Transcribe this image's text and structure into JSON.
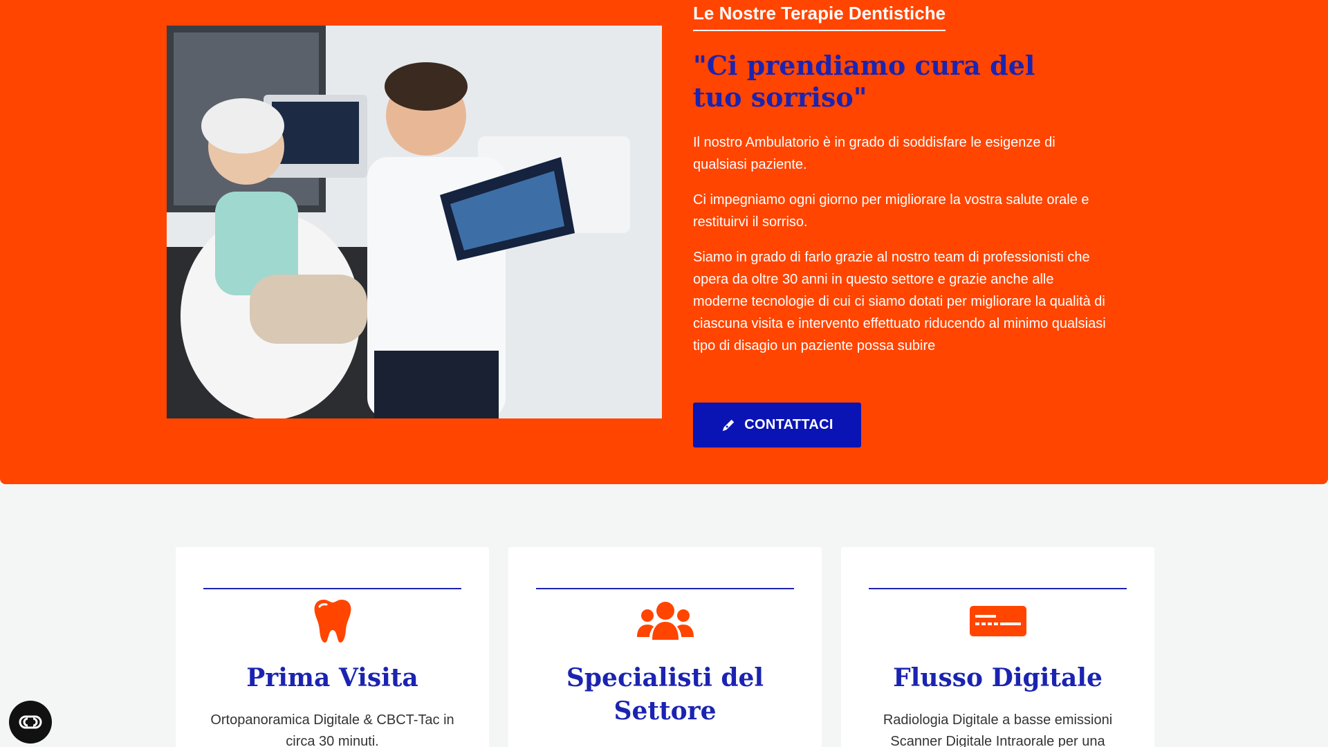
{
  "hero": {
    "section_heading": "Le Nostre Terapie Dentistiche",
    "tagline": "\"Ci prendiamo cura del tuo sorriso\"",
    "paragraphs": [
      "Il nostro Ambulatorio è in grado di soddisfare le esigenze di qualsiasi paziente.",
      "Ci impegniamo ogni giorno per migliorare la vostra salute orale e restituirvi il sorriso.",
      "Siamo in grado di farlo grazie al nostro team di professionisti che opera da oltre 30 anni in questo settore e grazie anche alle moderne tecnologie di cui ci siamo dotati per migliorare la qualità di ciascuna visita e intervento effettuato riducendo al minimo qualsiasi tipo di disagio un paziente possa subire"
    ],
    "cta_label": "CONTATTACI",
    "cta_icon": "pen-nib-icon",
    "photo": "dentist-with-patient-xray-photo"
  },
  "cards": [
    {
      "icon": "tooth-icon",
      "title": "Prima Visita",
      "text": "Ortopanoramica Digitale & CBCT-Tac in circa 30 minuti."
    },
    {
      "icon": "users-group-icon",
      "title": "Specialisti del Settore",
      "text": ""
    },
    {
      "icon": "digital-card-icon",
      "title": "Flusso Digitale",
      "text": "Radiologia Digitale a basse emissioni Scanner Digitale Intraorale per una"
    }
  ],
  "accessibility_button": {
    "icon": "accessibility-toggle-icon"
  },
  "colors": {
    "hero_background": "#ff4500",
    "accent_blue": "#1b24b0",
    "button_blue": "#0a14b4",
    "page_background": "#f4f6f5"
  }
}
